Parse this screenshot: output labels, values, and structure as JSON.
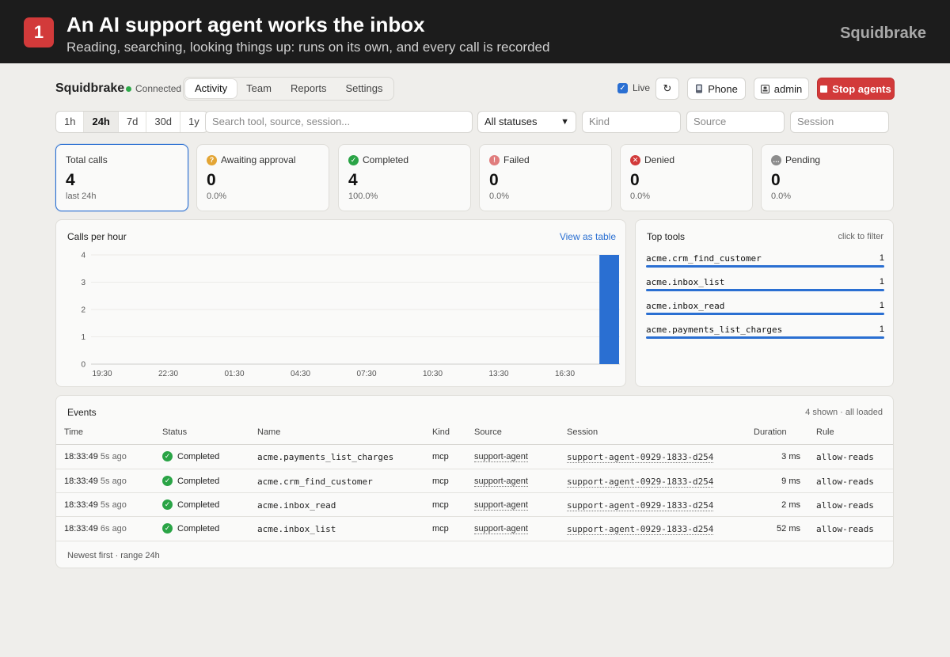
{
  "banner": {
    "step": "1",
    "title": "An AI support agent works the inbox",
    "subtitle": "Reading, searching, looking things up: runs on its own, and every call is recorded",
    "brand": "Squidbrake"
  },
  "app": {
    "brand": "Squidbrake",
    "connection": "Connected"
  },
  "tabs": [
    {
      "label": "Activity",
      "active": true
    },
    {
      "label": "Team"
    },
    {
      "label": "Reports"
    },
    {
      "label": "Settings"
    }
  ],
  "toolbar": {
    "live_label": "Live",
    "live_checked": true,
    "refresh_icon": "↻",
    "phone_label": "Phone",
    "admin_label": "admin",
    "stop_label": "Stop agents"
  },
  "filters": {
    "ranges": [
      "1h",
      "24h",
      "7d",
      "30d",
      "1y"
    ],
    "active_range": "24h",
    "search_placeholder": "Search tool, source, session...",
    "status_value": "All statuses",
    "kind_placeholder": "Kind",
    "source_placeholder": "Source",
    "session_placeholder": "Session"
  },
  "stats": [
    {
      "label": "Total calls",
      "value": "4",
      "sub": "last 24h",
      "icon": ""
    },
    {
      "label": "Awaiting approval",
      "value": "0",
      "sub": "0.0%",
      "icon": "question-icon",
      "glyph": "?"
    },
    {
      "label": "Completed",
      "value": "4",
      "sub": "100.0%",
      "icon": "check-icon",
      "glyph": "✓"
    },
    {
      "label": "Failed",
      "value": "0",
      "sub": "0.0%",
      "icon": "alert-icon",
      "glyph": "!"
    },
    {
      "label": "Denied",
      "value": "0",
      "sub": "0.0%",
      "icon": "deny-icon",
      "glyph": "✕"
    },
    {
      "label": "Pending",
      "value": "0",
      "sub": "0.0%",
      "icon": "pending-icon",
      "glyph": "…"
    }
  ],
  "calls_chart": {
    "title": "Calls per hour",
    "link": "View as table"
  },
  "chart_data": {
    "type": "bar",
    "title": "Calls per hour",
    "xlabel": "",
    "ylabel": "",
    "x_tick_labels": [
      "19:30",
      "22:30",
      "01:30",
      "04:30",
      "07:30",
      "10:30",
      "13:30",
      "16:30"
    ],
    "y_ticks": [
      0,
      1,
      2,
      3,
      4
    ],
    "ylim": [
      0,
      4
    ],
    "categories": [
      "18:30"
    ],
    "values": [
      4
    ],
    "color": "#2a6fd2",
    "grid": true
  },
  "top_tools": {
    "title": "Top tools",
    "note": "click to filter",
    "items": [
      {
        "name": "acme.crm_find_customer",
        "count": "1",
        "share": 1.0
      },
      {
        "name": "acme.inbox_list",
        "count": "1",
        "share": 1.0
      },
      {
        "name": "acme.inbox_read",
        "count": "1",
        "share": 1.0
      },
      {
        "name": "acme.payments_list_charges",
        "count": "1",
        "share": 1.0
      }
    ]
  },
  "events": {
    "title": "Events",
    "note": "4 shown · all loaded",
    "columns": [
      "Time",
      "Status",
      "Name",
      "Kind",
      "Source",
      "Session",
      "Duration",
      "Rule"
    ],
    "rows": [
      {
        "time": "18:33:49",
        "ago": "5s ago",
        "status": "Completed",
        "name": "acme.payments_list_charges",
        "kind": "mcp",
        "source": "support-agent",
        "session": "support-agent-0929-1833-d254",
        "duration": "3 ms",
        "rule": "allow-reads"
      },
      {
        "time": "18:33:49",
        "ago": "5s ago",
        "status": "Completed",
        "name": "acme.crm_find_customer",
        "kind": "mcp",
        "source": "support-agent",
        "session": "support-agent-0929-1833-d254",
        "duration": "9 ms",
        "rule": "allow-reads"
      },
      {
        "time": "18:33:49",
        "ago": "5s ago",
        "status": "Completed",
        "name": "acme.inbox_read",
        "kind": "mcp",
        "source": "support-agent",
        "session": "support-agent-0929-1833-d254",
        "duration": "2 ms",
        "rule": "allow-reads"
      },
      {
        "time": "18:33:49",
        "ago": "6s ago",
        "status": "Completed",
        "name": "acme.inbox_list",
        "kind": "mcp",
        "source": "support-agent",
        "session": "support-agent-0929-1833-d254",
        "duration": "52 ms",
        "rule": "allow-reads"
      }
    ],
    "footer": "Newest first · range 24h"
  }
}
